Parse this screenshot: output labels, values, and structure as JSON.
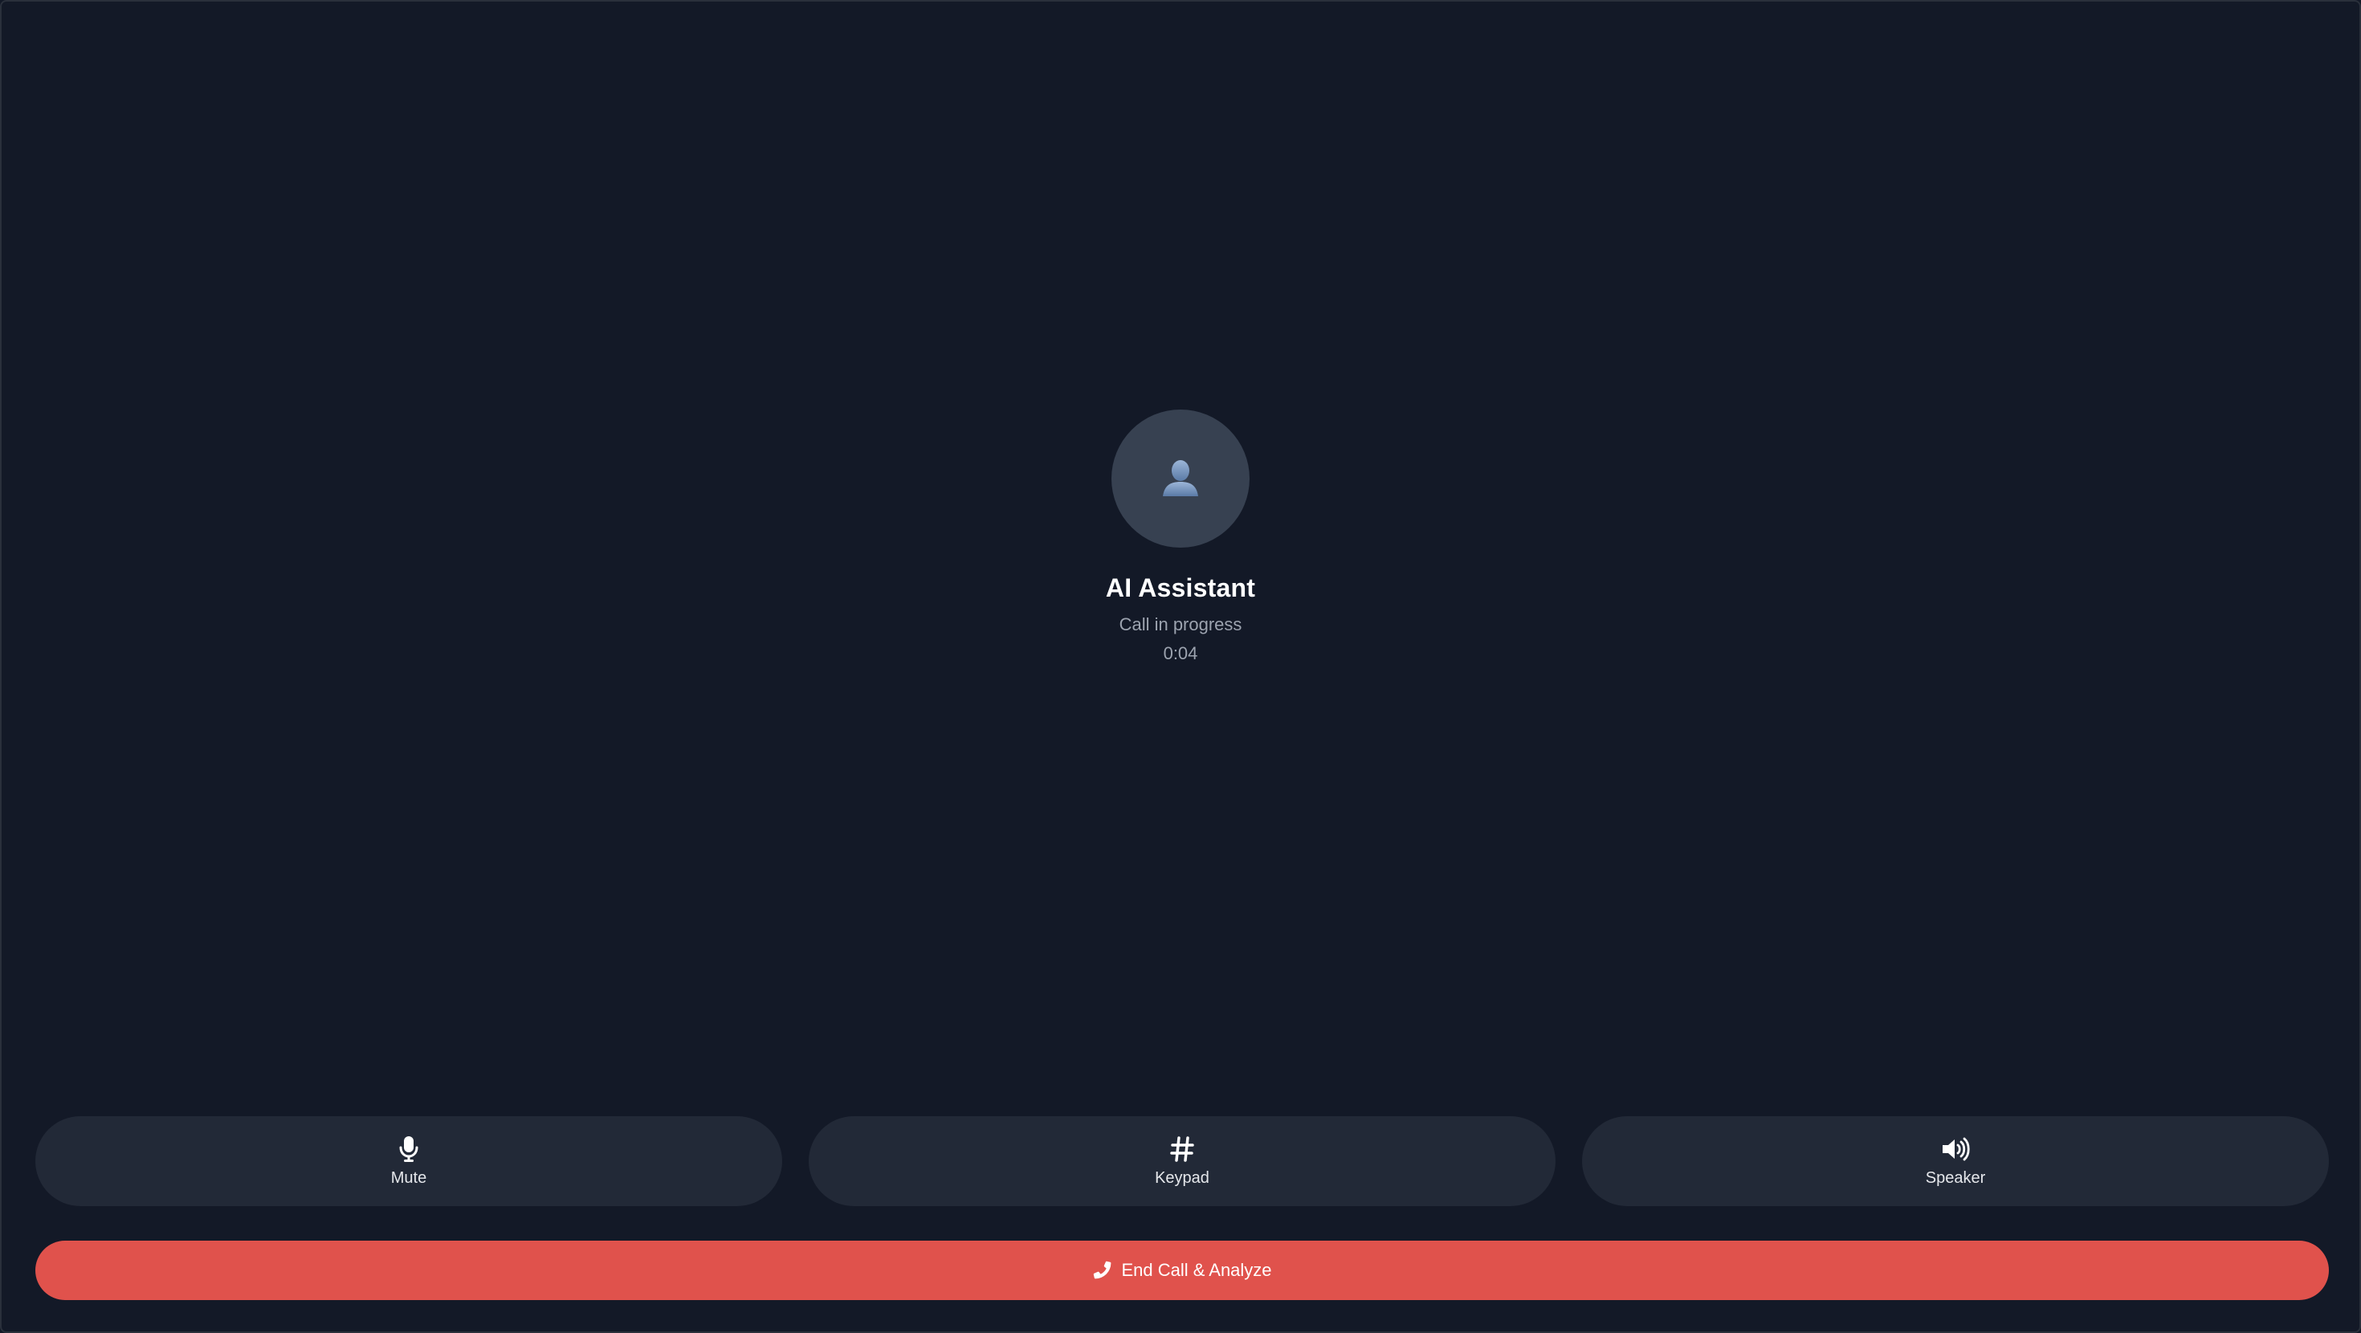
{
  "caller": {
    "avatar_icon": "person-silhouette-icon",
    "name": "AI Assistant",
    "status": "Call in progress",
    "timer": "0:04"
  },
  "controls": [
    {
      "label": "Mute",
      "icon": "microphone-icon"
    },
    {
      "label": "Keypad",
      "icon": "hash-icon"
    },
    {
      "label": "Speaker",
      "icon": "speaker-icon"
    }
  ],
  "end_call": {
    "label": "End Call & Analyze",
    "icon": "phone-icon",
    "color": "#e0524c"
  },
  "colors": {
    "background": "#131927",
    "avatar_bg": "#374151",
    "control_bg": "#222937",
    "muted_text": "#9ca3af"
  }
}
